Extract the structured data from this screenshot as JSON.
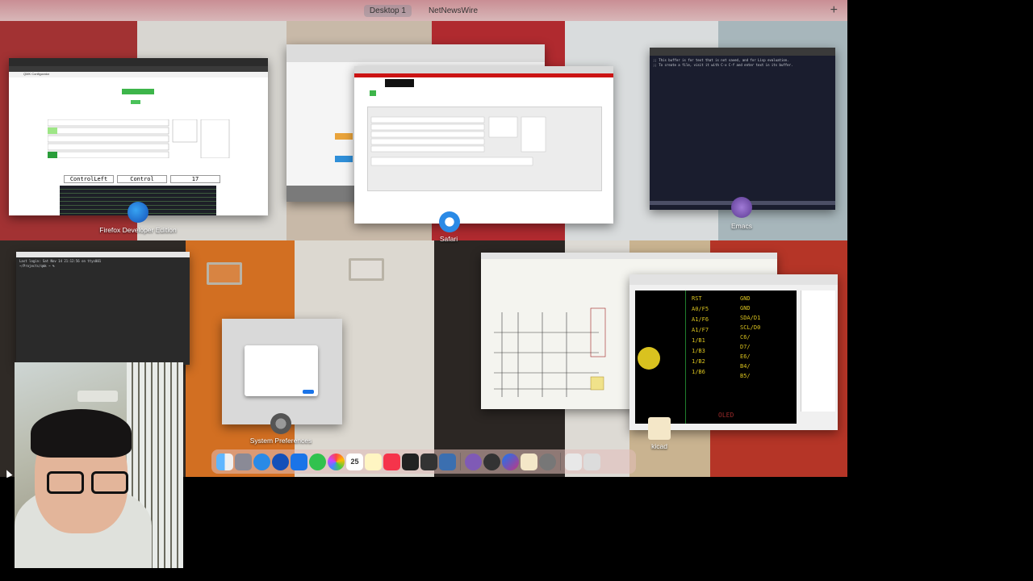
{
  "spaces": {
    "items": [
      "Desktop 1",
      "NetNewsWire"
    ],
    "active_index": 0,
    "add_label": "+"
  },
  "windows": {
    "firefox": {
      "app_label": "Firefox Developer Edition",
      "page_title": "QMK Configurator",
      "row_values": [
        "ControlLeft",
        "Control",
        "17"
      ]
    },
    "safari": {
      "app_label": "Safari"
    },
    "emacs": {
      "app_label": "Emacs"
    },
    "system_preferences": {
      "app_label": "System Preferences"
    },
    "kicad": {
      "app_label": "kicad",
      "pcb_labels_left": [
        "RST",
        "A0/F5",
        "A1/F6",
        "A1/F7",
        "1/B1",
        "1/B3",
        "1/B2",
        "1/B6"
      ],
      "pcb_labels_right": [
        "GND",
        "GND",
        "SDA/D1",
        "SCL/D0",
        "C6/",
        "D7/",
        "E6/",
        "B4/",
        "B5/"
      ],
      "pcb_bottom_label": "OLED"
    }
  },
  "dock": {
    "calendar_day": "25",
    "icons": [
      "finder-icon",
      "launchpad-icon",
      "safari-icon",
      "firefox-icon",
      "xcode-icon",
      "messages-icon",
      "photos-icon",
      "calendar-icon",
      "notes-icon",
      "music-icon",
      "terminal-icon",
      "psi-icon",
      "tasks-icon",
      "emacs-icon",
      "obs-icon",
      "messenger-icon",
      "kicad-icon",
      "system-preferences-icon",
      "document-icon",
      "trash-icon"
    ]
  },
  "colors": {
    "accent_blue": "#1b74e8",
    "emacs_purple": "#7f5ab6",
    "kicad_green": "#0a7d2a",
    "pcb_yellow": "#d9c21f"
  }
}
